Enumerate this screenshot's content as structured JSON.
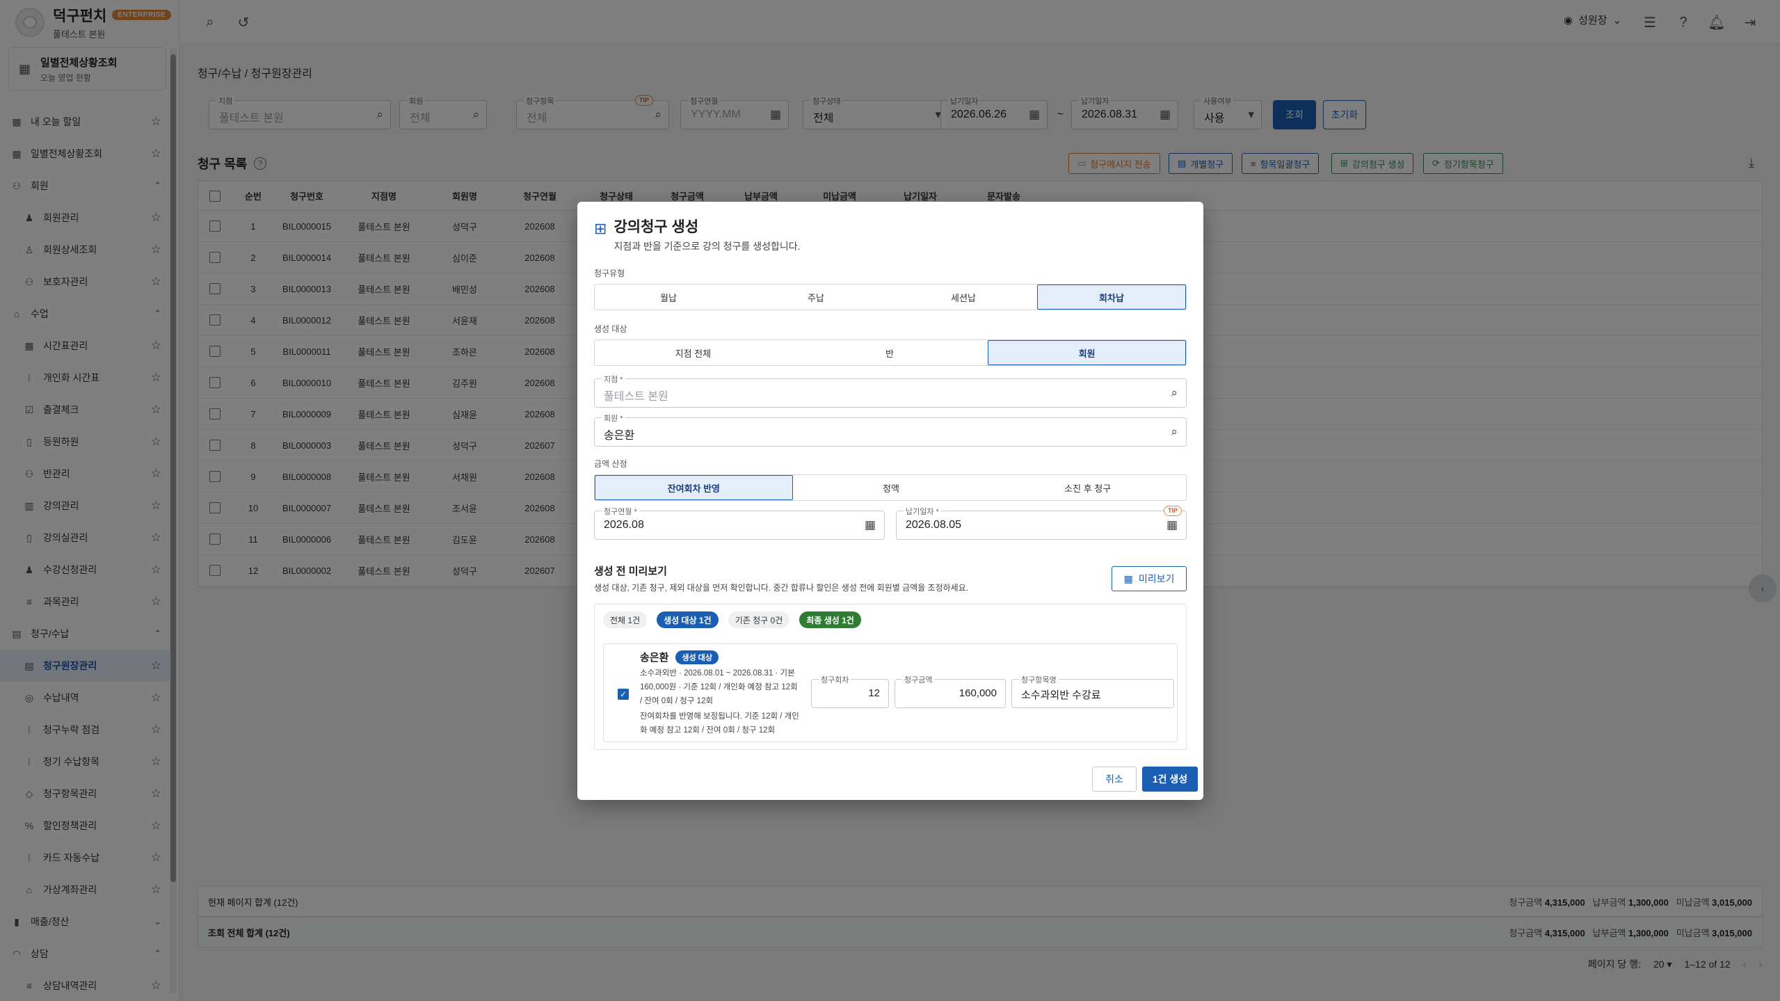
{
  "app": {
    "name": "덕구펀치",
    "edition": "ENTERPRISE",
    "branch": "풀테스트 본원"
  },
  "sidebar": {
    "quick": {
      "title": "일별전체상황조회",
      "sub": "오늘 영업 현황"
    },
    "items": [
      {
        "label": "내 오늘 할일",
        "icon": "grid-icon",
        "kind": "top"
      },
      {
        "label": "일별전체상황조회",
        "icon": "grid-icon",
        "kind": "top"
      },
      {
        "label": "회원",
        "icon": "people-icon",
        "kind": "group",
        "chev": "⌃"
      },
      {
        "label": "회원관리",
        "icon": "person-icon",
        "kind": "sub"
      },
      {
        "label": "회원상세조회",
        "icon": "person-search-icon",
        "kind": "sub"
      },
      {
        "label": "보호자관리",
        "icon": "people-icon",
        "kind": "sub"
      },
      {
        "label": "수업",
        "icon": "school-icon",
        "kind": "group",
        "chev": "⌃"
      },
      {
        "label": "시간표관리",
        "icon": "calendar-icon",
        "kind": "sub"
      },
      {
        "label": "개인화 시간표",
        "icon": "grid-dots-icon",
        "kind": "sub"
      },
      {
        "label": "출결체크",
        "icon": "checklist-icon",
        "kind": "sub"
      },
      {
        "label": "등원하원",
        "icon": "door-icon",
        "kind": "sub"
      },
      {
        "label": "반관리",
        "icon": "people-icon",
        "kind": "sub"
      },
      {
        "label": "강의관리",
        "icon": "book-icon",
        "kind": "sub"
      },
      {
        "label": "강의실관리",
        "icon": "door-icon",
        "kind": "sub"
      },
      {
        "label": "수강신청관리",
        "icon": "person-add-icon",
        "kind": "sub"
      },
      {
        "label": "과목관리",
        "icon": "list-icon",
        "kind": "sub"
      },
      {
        "label": "청구/수납",
        "icon": "wallet-icon",
        "kind": "group",
        "chev": "⌃"
      },
      {
        "label": "청구원장관리",
        "icon": "ledger-icon",
        "kind": "sub",
        "active": true
      },
      {
        "label": "수납내역",
        "icon": "coin-icon",
        "kind": "sub"
      },
      {
        "label": "청구누락 점검",
        "icon": "grid-dots-icon",
        "kind": "sub"
      },
      {
        "label": "정기 수납항목",
        "icon": "grid-dots-icon",
        "kind": "sub"
      },
      {
        "label": "청구항목관리",
        "icon": "tag-icon",
        "kind": "sub"
      },
      {
        "label": "할인정책관리",
        "icon": "percent-icon",
        "kind": "sub"
      },
      {
        "label": "카드 자동수납",
        "icon": "grid-dots-icon",
        "kind": "sub"
      },
      {
        "label": "가상계좌관리",
        "icon": "bank-icon",
        "kind": "sub"
      },
      {
        "label": "매출/정산",
        "icon": "bar-chart-icon",
        "kind": "group",
        "chev": "⌄"
      },
      {
        "label": "상담",
        "icon": "headset-icon",
        "kind": "group",
        "chev": "⌃"
      },
      {
        "label": "상담내역관리",
        "icon": "list-icon",
        "kind": "sub"
      }
    ]
  },
  "topbar": {
    "user": "성원장"
  },
  "breadcrumb": "청구/수납  /  청구원장관리",
  "filters": {
    "branch": {
      "label": "지점",
      "value": "풀테스트 본원"
    },
    "member": {
      "label": "회원",
      "value": "전체"
    },
    "item": {
      "label": "청구항목",
      "value": "전체",
      "tip": "TIP"
    },
    "month": {
      "label": "청구연월",
      "value": "YYYY.MM"
    },
    "status": {
      "label": "청구상태",
      "value": "전체"
    },
    "due_from": {
      "label": "납기일자",
      "value": "2026.06.26"
    },
    "tilde": "~",
    "due_to": {
      "label": "납기일자",
      "value": "2026.08.31"
    },
    "use": {
      "label": "사용여부",
      "value": "사용"
    },
    "search_btn": "조회",
    "reset_btn": "초기화"
  },
  "list": {
    "title": "청구 목록",
    "actions": [
      "청구메시지 전송",
      "개별청구",
      "항목일괄청구",
      "강의청구 생성",
      "정기항목청구"
    ],
    "columns": [
      "순번",
      "청구번호",
      "지점명",
      "회원명",
      "청구연월",
      "청구상태",
      "청구금액",
      "납부금액",
      "미납금액",
      "납기일자",
      "문자발송"
    ],
    "rows": [
      [
        "1",
        "BIL0000015",
        "풀테스트 본원",
        "성덕구",
        "202608"
      ],
      [
        "2",
        "BIL0000014",
        "풀테스트 본원",
        "심이준",
        "202608"
      ],
      [
        "3",
        "BIL0000013",
        "풀테스트 본원",
        "배민성",
        "202608"
      ],
      [
        "4",
        "BIL0000012",
        "풀테스트 본원",
        "서윤재",
        "202608"
      ],
      [
        "5",
        "BIL0000011",
        "풀테스트 본원",
        "조하은",
        "202608"
      ],
      [
        "6",
        "BIL0000010",
        "풀테스트 본원",
        "김주원",
        "202608"
      ],
      [
        "7",
        "BIL0000009",
        "풀테스트 본원",
        "심재윤",
        "202608"
      ],
      [
        "8",
        "BIL0000003",
        "풀테스트 본원",
        "성덕구",
        "202607"
      ],
      [
        "9",
        "BIL0000008",
        "풀테스트 본원",
        "서채원",
        "202608"
      ],
      [
        "10",
        "BIL0000007",
        "풀테스트 본원",
        "조서윤",
        "202608"
      ],
      [
        "11",
        "BIL0000006",
        "풀테스트 본원",
        "김도윤",
        "202608"
      ],
      [
        "12",
        "BIL0000002",
        "풀테스트 본원",
        "성덕구",
        "202607"
      ]
    ],
    "page_total": {
      "label": "현재 페이지 합계 (12건)",
      "billed_label": "청구금액",
      "billed": "4,315,000",
      "paid_label": "납부금액",
      "paid": "1,300,000",
      "unpaid_label": "미납금액",
      "unpaid": "3,015,000"
    },
    "grand_total": {
      "label": "조회 전체 합계 (12건)",
      "billed_label": "청구금액",
      "billed": "4,315,000",
      "paid_label": "납부금액",
      "paid": "1,300,000",
      "unpaid_label": "미납금액",
      "unpaid": "3,015,000"
    },
    "pager": {
      "per_page_label": "페이지 당 행:",
      "per_page": "20",
      "range": "1–12 of 12"
    }
  },
  "modal": {
    "title": "강의청구 생성",
    "desc": "지점과 반을 기준으로 강의 청구를 생성합니다.",
    "type_label": "청구유형",
    "types": [
      "월납",
      "주납",
      "세션납",
      "회차납"
    ],
    "type_selected": 3,
    "target_label": "생성 대상",
    "targets": [
      "지점 전체",
      "반",
      "회원"
    ],
    "target_selected": 2,
    "branch": {
      "label": "지점 *",
      "value": "풀테스트 본원"
    },
    "member": {
      "label": "회원 *",
      "value": "송은환"
    },
    "amount_label": "금액 산정",
    "amounts": [
      "잔여회차 반영",
      "정액",
      "소진 후 청구"
    ],
    "amount_selected": 0,
    "bill_month": {
      "label": "청구연월 *",
      "value": "2026.08"
    },
    "due_date": {
      "label": "납기일자 *",
      "value": "2026.08.05",
      "tip": "TIP"
    },
    "preview": {
      "title": "생성 전 미리보기",
      "desc": "생성 대상, 기존 청구, 제외 대상을 먼저 확인합니다. 중간 합류나 할인은 생성 전에 회원별 금액을 조정하세요.",
      "button": "미리보기",
      "chips": [
        "전체 1건",
        "생성 대상 1건",
        "기존 청구 0건",
        "최종 생성 1건"
      ],
      "item": {
        "name": "송은환",
        "badge": "생성 대상",
        "desc1": "소수과외반 · 2026.08.01 ~ 2026.08.31 · 기본 160,000원 · 기준 12회 / 개인화 예정 참고 12회 / 잔여 0회 / 청구 12회",
        "desc2": "잔여회차를 반영해 보정됩니다. 기준 12회 / 개인화 예정 참고 12회 / 잔여 0회 / 청구 12회",
        "count_label": "청구회차",
        "count": "12",
        "amount_label": "청구금액",
        "amount": "160,000",
        "name_label": "청구항목명",
        "item_name": "소수과외반 수강료"
      }
    },
    "cancel": "취소",
    "confirm": "1건 생성"
  },
  "colors": {
    "primary": "#1a5fb4",
    "orange": "#e2772b",
    "green": "#2e7d32"
  }
}
